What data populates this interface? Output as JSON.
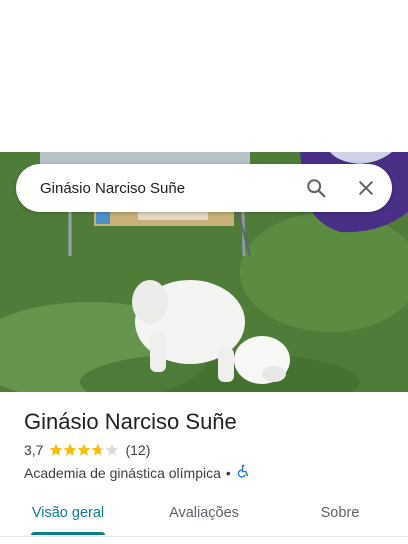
{
  "search": {
    "value": "Ginásio Narciso Suñe",
    "icons": {
      "search": "search-icon",
      "close": "close-icon"
    }
  },
  "place": {
    "name": "Ginásio Narciso Suñe",
    "rating": "3,7",
    "rating_value": 3.7,
    "reviews": "(12)",
    "category": "Academia de ginástica olímpica",
    "separator": "•",
    "accessibility_icon": "wheelchair-icon"
  },
  "tabs": [
    {
      "label": "Visão geral",
      "active": true
    },
    {
      "label": "Avaliações",
      "active": false
    },
    {
      "label": "Sobre",
      "active": false
    }
  ],
  "colors": {
    "accent": "#0b7f8a",
    "star": "#fbbc04",
    "star_empty": "#dadce0",
    "accessibility": "#1a73e8"
  }
}
